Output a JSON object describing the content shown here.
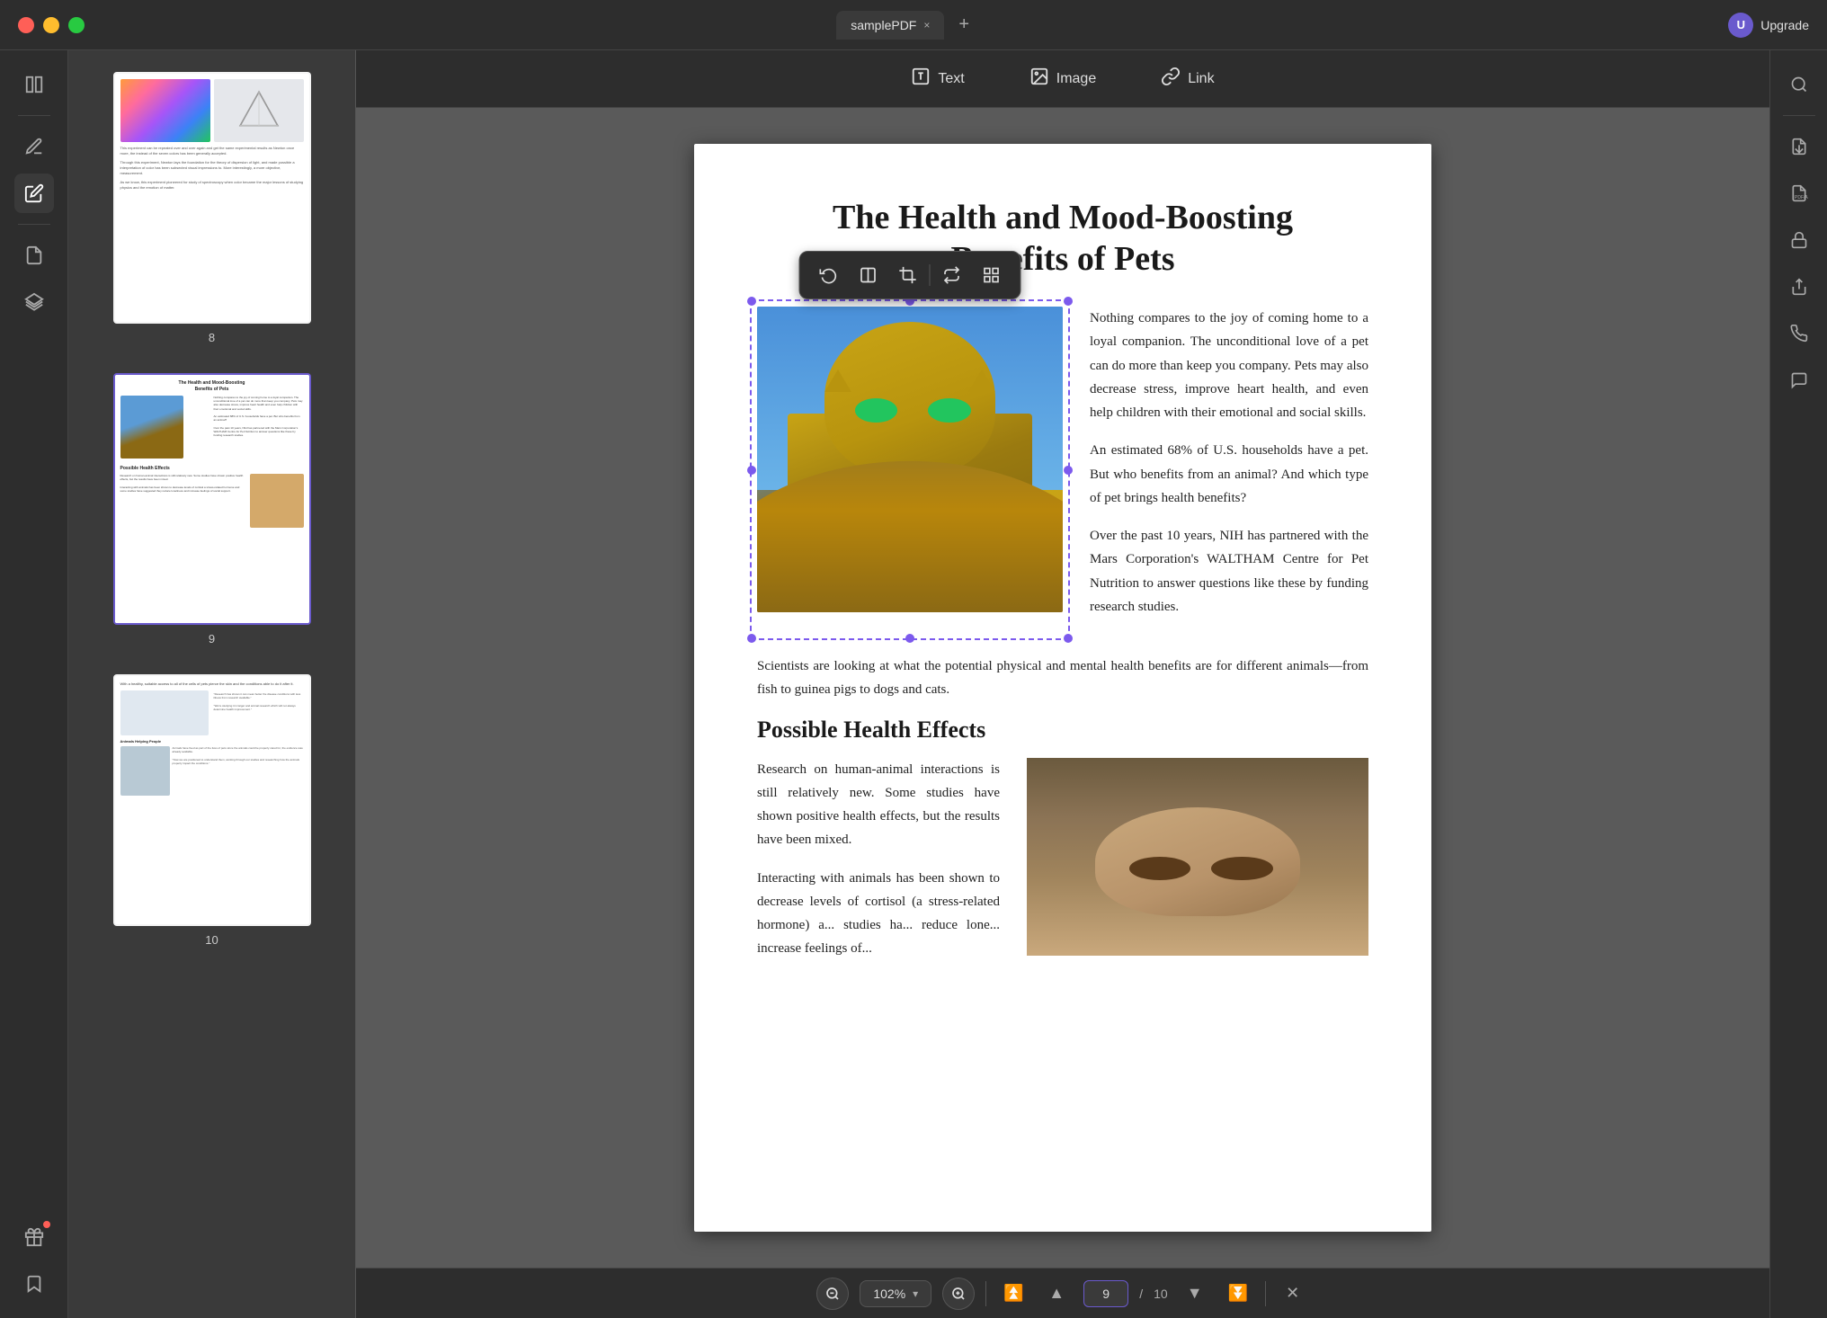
{
  "titlebar": {
    "tab_name": "samplePDF",
    "close_tab_label": "×",
    "add_tab_label": "+",
    "upgrade_label": "Upgrade",
    "user_initial": "U"
  },
  "toolbar": {
    "text_label": "Text",
    "image_label": "Image",
    "link_label": "Link"
  },
  "floating_toolbar": {
    "btn1": "⬡",
    "btn2": "⬜",
    "btn3": "⊞",
    "btn4": "↪",
    "btn5": "⊞⊞"
  },
  "page_content": {
    "title_line1": "The Health and Mood-Boosting",
    "title_line2": "Benefits of Pets",
    "para1": "Nothing compares to the joy of coming home to a loyal companion. The unconditional love of a pet can do more than keep you company. Pets may also decrease stress, improve heart health,  and  even  help children  with  their emotional and social skills.",
    "para2": "An estimated 68% of U.S. households have a pet. But who benefits from an animal? And which type of pet brings health benefits?",
    "para3": "Over  the  past  10  years,  NIH  has partnered with the Mars Corporation's WALTHAM Centre for  Pet  Nutrition  to answer  questions  like these by funding research studies.",
    "para4": "Scientists are looking at what the potential physical and mental health benefits are for different animals—from fish to guinea pigs to dogs and cats.",
    "section_title": "Possible Health Effects",
    "para5": "Research  on  human-animal  interactions is still  relatively  new.  Some  studies  have shown  positive  health  effects,  but  the results have been mixed.",
    "para6": "Interacting with animals has been shown to decrease levels of cortisol (a stress-related hormone) a... studies ha... reduce lone... increase feelings of..."
  },
  "thumbnails": [
    {
      "page_num": "8",
      "active": false
    },
    {
      "page_num": "9",
      "active": true
    },
    {
      "page_num": "10",
      "active": false
    }
  ],
  "bottom_bar": {
    "zoom_level": "102%",
    "current_page": "9",
    "total_pages": "10",
    "separator": "/"
  },
  "sidebar_left": {
    "icons": [
      {
        "name": "panel-icon",
        "symbol": "⊞",
        "active": false
      },
      {
        "name": "edit-icon",
        "symbol": "✏️",
        "active": false
      },
      {
        "name": "annotate-icon",
        "symbol": "🖊",
        "active": true
      },
      {
        "name": "pages-icon",
        "symbol": "📄",
        "active": false
      },
      {
        "name": "layers-icon",
        "symbol": "⧉",
        "active": false
      },
      {
        "name": "bookmark-icon",
        "symbol": "🔖",
        "active": false
      }
    ],
    "bottom_icons": [
      {
        "name": "gift-icon",
        "symbol": "🎁",
        "has_dot": true
      }
    ]
  },
  "sidebar_right": {
    "icons": [
      {
        "name": "search-icon",
        "symbol": "🔍"
      },
      {
        "name": "export-icon",
        "symbol": "📤"
      },
      {
        "name": "pdf-a-icon",
        "symbol": "📋"
      },
      {
        "name": "lock-icon",
        "symbol": "🔒"
      },
      {
        "name": "share-icon",
        "symbol": "↑"
      },
      {
        "name": "check-icon",
        "symbol": "✉"
      },
      {
        "name": "comment-icon",
        "symbol": "💬"
      }
    ]
  }
}
